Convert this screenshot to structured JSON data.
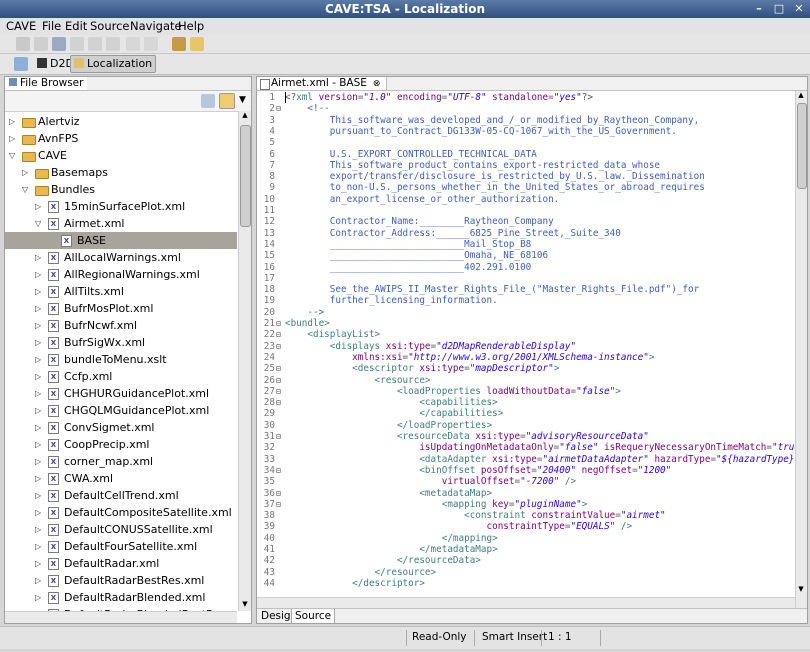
{
  "window": {
    "title": "CAVE:TSA - Localization"
  },
  "menu": [
    "CAVE",
    "File",
    "Edit",
    "Source",
    "Navigate",
    "Help"
  ],
  "perspectives": {
    "d2d": "D2D",
    "localization": "Localization"
  },
  "file_browser": {
    "tab_label": "File Browser",
    "tree": [
      {
        "label": "Alertviz",
        "type": "folder",
        "depth": 0,
        "expanded": false
      },
      {
        "label": "AvnFPS",
        "type": "folder",
        "depth": 0,
        "expanded": false
      },
      {
        "label": "CAVE",
        "type": "folder",
        "depth": 0,
        "expanded": true
      },
      {
        "label": "Basemaps",
        "type": "folder",
        "depth": 1,
        "expanded": false
      },
      {
        "label": "Bundles",
        "type": "folder",
        "depth": 1,
        "expanded": true
      },
      {
        "label": "15minSurfacePlot.xml",
        "type": "file",
        "depth": 2,
        "expanded": false
      },
      {
        "label": "Airmet.xml",
        "type": "file",
        "depth": 2,
        "expanded": true
      },
      {
        "label": "BASE",
        "type": "file",
        "depth": 3,
        "selected": true
      },
      {
        "label": "AllLocalWarnings.xml",
        "type": "file",
        "depth": 2,
        "expanded": false
      },
      {
        "label": "AllRegionalWarnings.xml",
        "type": "file",
        "depth": 2,
        "expanded": false
      },
      {
        "label": "AllTilts.xml",
        "type": "file",
        "depth": 2,
        "expanded": false
      },
      {
        "label": "BufrMosPlot.xml",
        "type": "file",
        "depth": 2,
        "expanded": false
      },
      {
        "label": "BufrNcwf.xml",
        "type": "file",
        "depth": 2,
        "expanded": false
      },
      {
        "label": "BufrSigWx.xml",
        "type": "file",
        "depth": 2,
        "expanded": false
      },
      {
        "label": "bundleToMenu.xslt",
        "type": "file",
        "depth": 2,
        "expanded": false
      },
      {
        "label": "Ccfp.xml",
        "type": "file",
        "depth": 2,
        "expanded": false
      },
      {
        "label": "CHGHURGuidancePlot.xml",
        "type": "file",
        "depth": 2,
        "expanded": false
      },
      {
        "label": "CHGQLMGuidancePlot.xml",
        "type": "file",
        "depth": 2,
        "expanded": false
      },
      {
        "label": "ConvSigmet.xml",
        "type": "file",
        "depth": 2,
        "expanded": false
      },
      {
        "label": "CoopPrecip.xml",
        "type": "file",
        "depth": 2,
        "expanded": false
      },
      {
        "label": "corner_map.xml",
        "type": "file",
        "depth": 2,
        "expanded": false
      },
      {
        "label": "CWA.xml",
        "type": "file",
        "depth": 2,
        "expanded": false
      },
      {
        "label": "DefaultCellTrend.xml",
        "type": "file",
        "depth": 2,
        "expanded": false
      },
      {
        "label": "DefaultCompositeSatellite.xml",
        "type": "file",
        "depth": 2,
        "expanded": false
      },
      {
        "label": "DefaultCONUSSatellite.xml",
        "type": "file",
        "depth": 2,
        "expanded": false
      },
      {
        "label": "DefaultFourSatellite.xml",
        "type": "file",
        "depth": 2,
        "expanded": false
      },
      {
        "label": "DefaultRadar.xml",
        "type": "file",
        "depth": 2,
        "expanded": false
      },
      {
        "label": "DefaultRadarBestRes.xml",
        "type": "file",
        "depth": 2,
        "expanded": false
      },
      {
        "label": "DefaultRadarBlended.xml",
        "type": "file",
        "depth": 2,
        "expanded": false
      },
      {
        "label": "DefaultRadarBlendedBestRes.xml",
        "type": "file",
        "depth": 2,
        "expanded": false
      }
    ]
  },
  "editor": {
    "tab_label": "Airmet.xml - BASE",
    "bottom_tabs": [
      "Design",
      "Source"
    ],
    "lines": [
      {
        "n": "1",
        "fold": "",
        "parts": [
          [
            "pl",
            "<?"
          ],
          [
            "tg",
            "xml "
          ],
          [
            "an",
            "version"
          ],
          [
            "pl",
            "="
          ],
          [
            "av",
            "\"1.0\""
          ],
          [
            "an",
            " encoding"
          ],
          [
            "pl",
            "="
          ],
          [
            "av",
            "\"UTF-8\""
          ],
          [
            "an",
            " standalone"
          ],
          [
            "pl",
            "="
          ],
          [
            "av",
            "\"yes\""
          ],
          [
            "pl",
            "?>"
          ]
        ]
      },
      {
        "n": "2",
        "fold": "⊟",
        "parts": [
          [
            "cm",
            "    <!--"
          ]
        ]
      },
      {
        "n": "3",
        "fold": "",
        "parts": [
          [
            "cm",
            "        This_software_was_developed_and_/_or_modified_by_Raytheon_Company,"
          ]
        ]
      },
      {
        "n": "4",
        "fold": "",
        "parts": [
          [
            "cm",
            "        pursuant_to_Contract_DG133W-05-CQ-1067_with_the_US_Government."
          ]
        ]
      },
      {
        "n": "5",
        "fold": "",
        "parts": [
          [
            "cm",
            ""
          ]
        ]
      },
      {
        "n": "6",
        "fold": "",
        "parts": [
          [
            "cm",
            "        U.S._EXPORT_CONTROLLED_TECHNICAL_DATA"
          ]
        ]
      },
      {
        "n": "7",
        "fold": "",
        "parts": [
          [
            "cm",
            "        This_software_product_contains_export-restricted_data_whose"
          ]
        ]
      },
      {
        "n": "8",
        "fold": "",
        "parts": [
          [
            "cm",
            "        export/transfer/disclosure_is_restricted_by_U.S._law._Dissemination"
          ]
        ]
      },
      {
        "n": "9",
        "fold": "",
        "parts": [
          [
            "cm",
            "        to_non-U.S._persons_whether_in_the_United_States_or_abroad_requires"
          ]
        ]
      },
      {
        "n": "10",
        "fold": "",
        "parts": [
          [
            "cm",
            "        an_export_license_or_other_authorization."
          ]
        ]
      },
      {
        "n": "11",
        "fold": "",
        "parts": [
          [
            "cm",
            ""
          ]
        ]
      },
      {
        "n": "12",
        "fold": "",
        "parts": [
          [
            "cm",
            "        Contractor_Name:________Raytheon_Company"
          ]
        ]
      },
      {
        "n": "13",
        "fold": "",
        "parts": [
          [
            "cm",
            "        Contractor_Address:______6825_Pine_Street,_Suite_340"
          ]
        ]
      },
      {
        "n": "14",
        "fold": "",
        "parts": [
          [
            "cm",
            "        ________________________Mail_Stop_B8"
          ]
        ]
      },
      {
        "n": "15",
        "fold": "",
        "parts": [
          [
            "cm",
            "        ________________________Omaha,_NE_68106"
          ]
        ]
      },
      {
        "n": "16",
        "fold": "",
        "parts": [
          [
            "cm",
            "        ________________________402.291.0100"
          ]
        ]
      },
      {
        "n": "17",
        "fold": "",
        "parts": [
          [
            "cm",
            ""
          ]
        ]
      },
      {
        "n": "18",
        "fold": "",
        "parts": [
          [
            "cm",
            "        See_the_AWIPS_II_Master_Rights_File_(\"Master_Rights_File.pdf\")_for"
          ]
        ]
      },
      {
        "n": "19",
        "fold": "",
        "parts": [
          [
            "cm",
            "        further_licensing_information."
          ]
        ]
      },
      {
        "n": "20",
        "fold": "",
        "parts": [
          [
            "cm",
            "    -->"
          ]
        ]
      },
      {
        "n": "21",
        "fold": "⊟",
        "parts": [
          [
            "tg",
            "<bundle>"
          ]
        ]
      },
      {
        "n": "22",
        "fold": "⊟",
        "parts": [
          [
            "tg",
            "    <displayList>"
          ]
        ]
      },
      {
        "n": "23",
        "fold": "⊟",
        "parts": [
          [
            "tg",
            "        <displays "
          ],
          [
            "an",
            "xsi:type"
          ],
          [
            "pl",
            "="
          ],
          [
            "av",
            "\"d2DMapRenderableDisplay\""
          ]
        ]
      },
      {
        "n": "24",
        "fold": "",
        "parts": [
          [
            "an",
            "            xmlns:xsi"
          ],
          [
            "pl",
            "="
          ],
          [
            "av",
            "\"http://www.w3.org/2001/XMLSchema-instance\""
          ],
          [
            "tg",
            ">"
          ]
        ]
      },
      {
        "n": "25",
        "fold": "⊟",
        "parts": [
          [
            "tg",
            "            <descriptor "
          ],
          [
            "an",
            "xsi:type"
          ],
          [
            "pl",
            "="
          ],
          [
            "av",
            "\"mapDescriptor\""
          ],
          [
            "tg",
            ">"
          ]
        ]
      },
      {
        "n": "26",
        "fold": "⊟",
        "parts": [
          [
            "tg",
            "                <resource>"
          ]
        ]
      },
      {
        "n": "27",
        "fold": "⊟",
        "parts": [
          [
            "tg",
            "                    <loadProperties "
          ],
          [
            "an",
            "loadWithoutData"
          ],
          [
            "pl",
            "="
          ],
          [
            "av",
            "\"false\""
          ],
          [
            "tg",
            ">"
          ]
        ]
      },
      {
        "n": "28",
        "fold": "⊟",
        "parts": [
          [
            "tg",
            "                        <capabilities>"
          ]
        ]
      },
      {
        "n": "29",
        "fold": "",
        "parts": [
          [
            "tg",
            "                        </capabilities>"
          ]
        ]
      },
      {
        "n": "30",
        "fold": "",
        "parts": [
          [
            "tg",
            "                    </loadProperties>"
          ]
        ]
      },
      {
        "n": "31",
        "fold": "⊟",
        "parts": [
          [
            "tg",
            "                    <resourceData "
          ],
          [
            "an",
            "xsi:type"
          ],
          [
            "pl",
            "="
          ],
          [
            "av",
            "\"advisoryResourceData\""
          ]
        ]
      },
      {
        "n": "32",
        "fold": "",
        "parts": [
          [
            "an",
            "                        isUpdatingOnMetadataOnly"
          ],
          [
            "pl",
            "="
          ],
          [
            "av",
            "\"false\""
          ],
          [
            "an",
            " isRequeryNecessaryOnTimeMatch"
          ],
          [
            "pl",
            "="
          ],
          [
            "av",
            "\"true\""
          ]
        ]
      },
      {
        "n": "33",
        "fold": "",
        "parts": [
          [
            "tg",
            "                        <dataAdapter "
          ],
          [
            "an",
            "xsi:type"
          ],
          [
            "pl",
            "="
          ],
          [
            "av",
            "\"airmetDataAdapter\""
          ],
          [
            "an",
            " hazardType"
          ],
          [
            "pl",
            "="
          ],
          [
            "av",
            "\"${hazardType}\""
          ]
        ]
      },
      {
        "n": "34",
        "fold": "⊟",
        "parts": [
          [
            "tg",
            "                        <binOffset "
          ],
          [
            "an",
            "posOffset"
          ],
          [
            "pl",
            "="
          ],
          [
            "av",
            "\"20400\""
          ],
          [
            "an",
            " negOffset"
          ],
          [
            "pl",
            "="
          ],
          [
            "av",
            "\"1200\""
          ]
        ]
      },
      {
        "n": "35",
        "fold": "",
        "parts": [
          [
            "an",
            "                            virtualOffset"
          ],
          [
            "pl",
            "="
          ],
          [
            "av",
            "\"-7200\""
          ],
          [
            "tg",
            " />"
          ]
        ]
      },
      {
        "n": "36",
        "fold": "⊟",
        "parts": [
          [
            "tg",
            "                        <metadataMap>"
          ]
        ]
      },
      {
        "n": "37",
        "fold": "⊟",
        "parts": [
          [
            "tg",
            "                            <mapping "
          ],
          [
            "an",
            "key"
          ],
          [
            "pl",
            "="
          ],
          [
            "av",
            "\"pluginName\""
          ],
          [
            "tg",
            ">"
          ]
        ]
      },
      {
        "n": "38",
        "fold": "",
        "parts": [
          [
            "tg",
            "                                <constraint "
          ],
          [
            "an",
            "constraintValue"
          ],
          [
            "pl",
            "="
          ],
          [
            "av",
            "\"airmet\""
          ]
        ]
      },
      {
        "n": "39",
        "fold": "",
        "parts": [
          [
            "an",
            "                                    constraintType"
          ],
          [
            "pl",
            "="
          ],
          [
            "av",
            "\"EQUALS\""
          ],
          [
            "tg",
            " />"
          ]
        ]
      },
      {
        "n": "40",
        "fold": "",
        "parts": [
          [
            "tg",
            "                            </mapping>"
          ]
        ]
      },
      {
        "n": "41",
        "fold": "",
        "parts": [
          [
            "tg",
            "                        </metadataMap>"
          ]
        ]
      },
      {
        "n": "42",
        "fold": "",
        "parts": [
          [
            "tg",
            "                    </resourceData>"
          ]
        ]
      },
      {
        "n": "43",
        "fold": "",
        "parts": [
          [
            "tg",
            "                </resource>"
          ]
        ]
      },
      {
        "n": "44",
        "fold": "",
        "parts": [
          [
            "tg",
            "            </descriptor>"
          ]
        ]
      }
    ]
  },
  "status": {
    "mode": "Read-Only",
    "insert": "Smart Insert",
    "position": "1 : 1"
  },
  "colors": {
    "selection": "#a7a49c",
    "comment": "#3f5fbf",
    "tag": "#3f7f7f",
    "attr": "#7f007f",
    "value": "#2a00ff"
  }
}
